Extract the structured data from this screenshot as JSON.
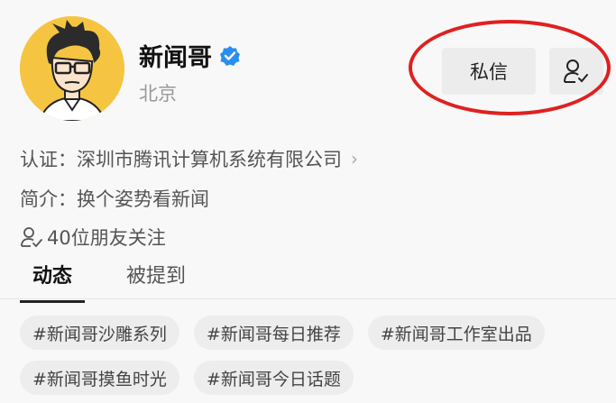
{
  "profile": {
    "name": "新闻哥",
    "location": "北京",
    "verified_color": "#2a8df0"
  },
  "actions": {
    "message_label": "私信",
    "follow_icon": "user-check-icon"
  },
  "info": {
    "certification": "认证：深圳市腾讯计算机系统有限公司",
    "intro": "简介：换个姿势看新闻",
    "friends_following": "40位朋友关注"
  },
  "tabs": [
    {
      "label": "动态",
      "active": true
    },
    {
      "label": "被提到",
      "active": false
    }
  ],
  "tags": [
    "#新闻哥沙雕系列",
    "#新闻哥每日推荐",
    "#新闻哥工作室出品",
    "#新闻哥摸鱼时光",
    "#新闻哥今日话题"
  ],
  "colors": {
    "highlight": "#e02020",
    "avatar_bg": "#f5c542"
  }
}
